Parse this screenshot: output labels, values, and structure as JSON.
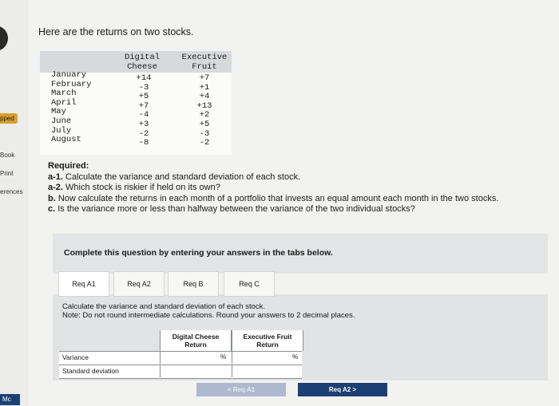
{
  "sidebar": {
    "skipped": "pped",
    "ebook": "Book",
    "print": "Print",
    "references": "erences",
    "mc": "Mc"
  },
  "intro": "Here are the returns on two stocks.",
  "returns_table": {
    "col1": [
      "Digital",
      "Cheese"
    ],
    "col2": [
      "Executive",
      "Fruit"
    ],
    "rows": [
      {
        "month": "January",
        "digital": "+14",
        "executive": "+7"
      },
      {
        "month": "February",
        "digital": "-3",
        "executive": "+1"
      },
      {
        "month": "March",
        "digital": "+5",
        "executive": "+4"
      },
      {
        "month": "April",
        "digital": "+7",
        "executive": "+13"
      },
      {
        "month": "May",
        "digital": "-4",
        "executive": "+2"
      },
      {
        "month": "June",
        "digital": "+3",
        "executive": "+5"
      },
      {
        "month": "July",
        "digital": "-2",
        "executive": "-3"
      },
      {
        "month": "August",
        "digital": "-8",
        "executive": "-2"
      }
    ]
  },
  "required": {
    "heading": "Required:",
    "a1_tag": "a-1.",
    "a1": "Calculate the variance and standard deviation of each stock.",
    "a2_tag": "a-2.",
    "a2": "Which stock is riskier if held on its own?",
    "b_tag": "b.",
    "b": "Now calculate the returns in each month of a portfolio that invests an equal amount each month in the two stocks.",
    "c_tag": "c.",
    "c": "Is the variance more or less than halfway between the variance of the two individual stocks?"
  },
  "banner": "Complete this question by entering your answers in the tabs below.",
  "tabs": [
    "Req A1",
    "Req A2",
    "Req B",
    "Req C"
  ],
  "instructions": {
    "line1": "Calculate the variance and standard deviation of each stock.",
    "line2": "Note: Do not round intermediate calculations. Round your answers to 2 decimal places."
  },
  "answer_table": {
    "col1": [
      "Digital Cheese",
      "Return"
    ],
    "col2": [
      "Executive Fruit",
      "Return"
    ],
    "rows": [
      "Variance",
      "Standard deviation"
    ],
    "unit": "%"
  },
  "nav": {
    "prev": "< Req A1",
    "next": "Req A2 >"
  }
}
